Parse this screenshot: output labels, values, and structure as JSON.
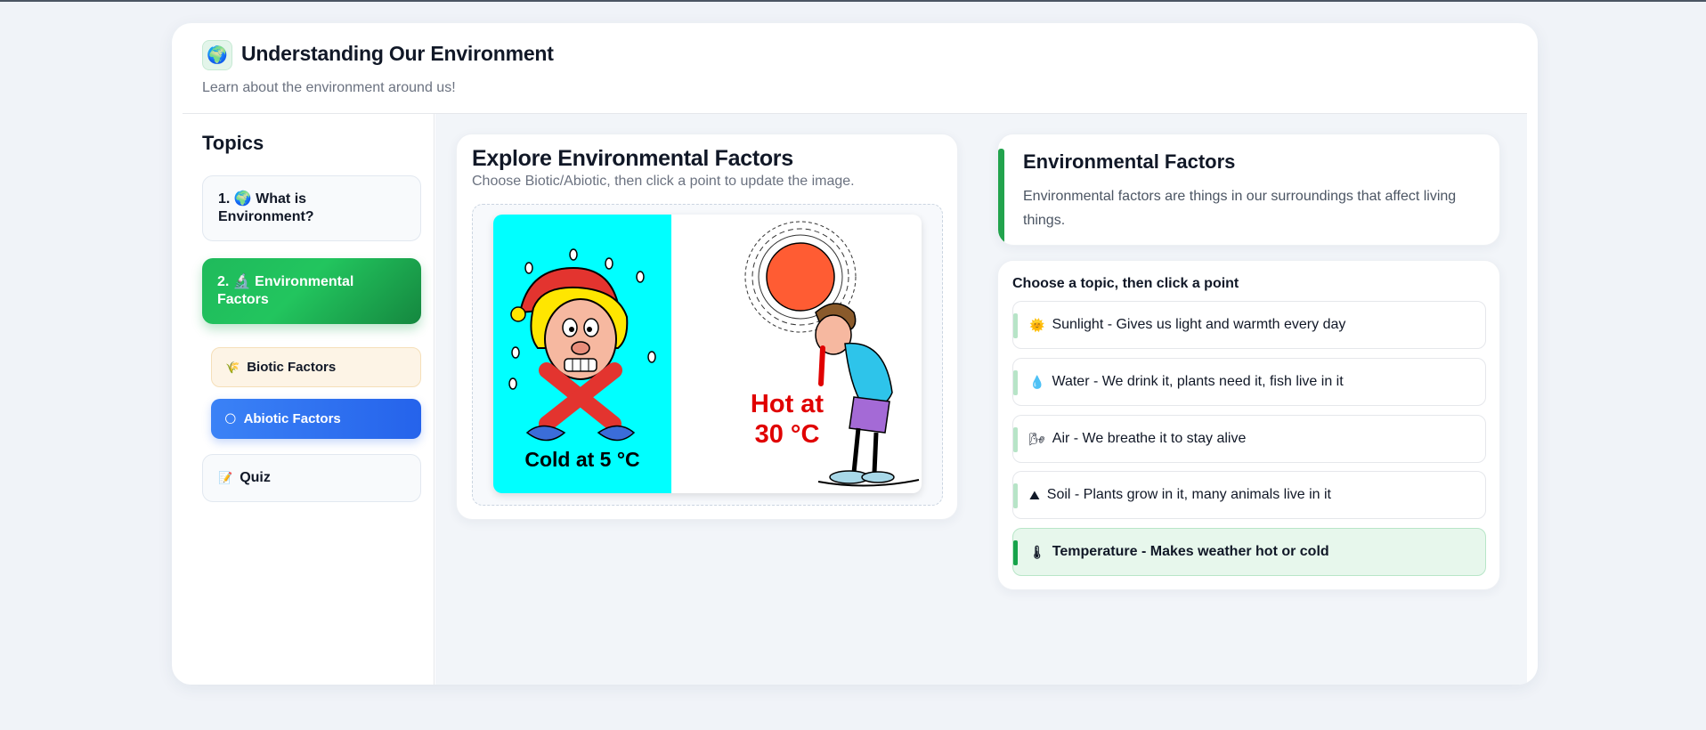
{
  "header": {
    "logo_icon": "🌍",
    "title": "Understanding Our Environment",
    "subtitle": "Learn about the environment around us!"
  },
  "sidebar": {
    "title": "Topics",
    "items": [
      {
        "label": "1. 🌍 What is Environment?"
      },
      {
        "label": "2. 🔬 Environmental Factors",
        "active": true
      },
      {
        "label": "Quiz",
        "icon": "📝"
      }
    ],
    "subitems": [
      {
        "label": "Biotic Factors",
        "icon": "🌾"
      },
      {
        "label": "Abiotic Factors",
        "icon": "🌕",
        "active": true
      }
    ]
  },
  "explore": {
    "title": "Explore Environmental Factors",
    "subtitle": "Choose Biotic/Abiotic, then click a point to update the image.",
    "image": {
      "cold_caption": "Cold at 5 °C",
      "hot_caption_line1": "Hot at",
      "hot_caption_line2": "30 °C",
      "cold_bg": "#00ffff",
      "sun_color": "#ff5c33",
      "hot_text_color": "#e00000"
    }
  },
  "info": {
    "title": "Environmental Factors",
    "text": "Environmental factors are things in our surroundings that affect living things.",
    "accent": "#22a34d"
  },
  "topics": {
    "heading": "Choose a topic, then click a point",
    "items": [
      {
        "icon": "🌞",
        "label": "Sunlight - Gives us light and warmth every day"
      },
      {
        "icon": "💧",
        "label": "Water - We drink it, plants need it, fish live in it"
      },
      {
        "icon": "🌬",
        "label": "Air - We breathe it to stay alive"
      },
      {
        "icon": "⛰",
        "label": "Soil - Plants grow in it, many animals live in it"
      },
      {
        "icon": "🌡",
        "label": "Temperature - Makes weather hot or cold",
        "active": true
      }
    ]
  }
}
